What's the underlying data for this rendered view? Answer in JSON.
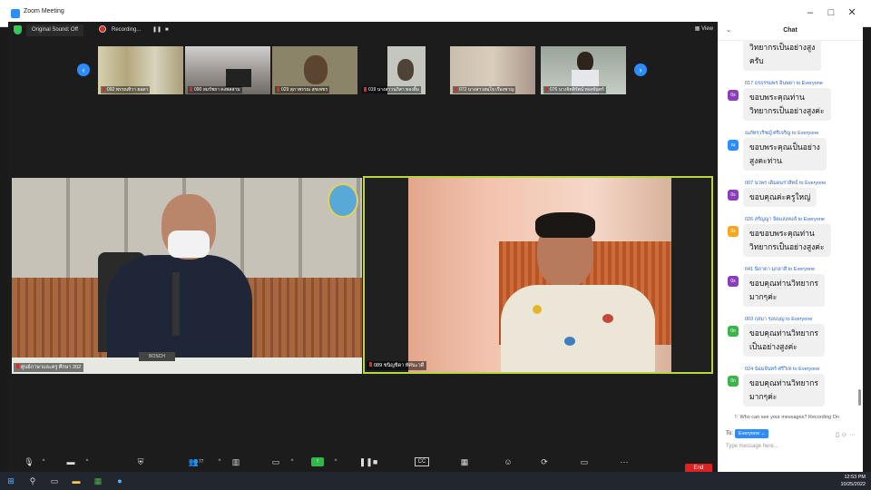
{
  "window": {
    "title": "Zoom Meeting"
  },
  "topbar": {
    "original_sound": "Original Sound: Off",
    "recording": "Recording...",
    "view": "View"
  },
  "thumbnails": [
    {
      "label": "092 พรรณทิวา ยอดา",
      "bg": "#c9c4a8"
    },
    {
      "label": "090 สมรัชยา คงพลสาม",
      "bg": "#8f8b88"
    },
    {
      "label": "029 สุภาพรรณ สุขเพชร",
      "bg": "#9c8f73"
    },
    {
      "label": "019 นางสาวนภิสา ทองยิ้ม",
      "bg": "#c8c8c4"
    },
    {
      "label": "072 นางสาวสมใจ เรืองชาญ",
      "bg": "#c2b6a4"
    },
    {
      "label": "076 นางจิตติรัตน์ ทองจันทร์",
      "bg": "#a6b0a8"
    }
  ],
  "main_videos": [
    {
      "label": "ศูนย์ภาษาและครู ศึกษา 202"
    },
    {
      "label": "089 ชนิญชิดา ทัศนะวดี"
    }
  ],
  "toolbar": {
    "participants_count": "77",
    "end": "End"
  },
  "chat": {
    "title": "Chat",
    "messages": [
      {
        "sender": "",
        "avatar": "",
        "color": "",
        "text": "วิทยากรเป็นอย่างสูง\nครับ"
      },
      {
        "sender": "017 ธรธรรมพร อินพยา to Everyone",
        "avatar": "0s",
        "color": "#8a3fb8",
        "text": "ขอบพระคุณท่าน\nวิทยากรเป็นอย่างสูงค่ะ"
      },
      {
        "sender": "ณภัทรวรีชญ์ ศรีเจริญ to Everyone",
        "avatar": "ณ",
        "color": "#2d8cff",
        "text": "ขอบพระคุณเป็นอย่าง\nสูงคะท่าน"
      },
      {
        "sender": "007 นวพร เดิมดนราสิทธ์ to Everyone",
        "avatar": "0s",
        "color": "#8a3fb8",
        "text": "ขอบคุณค่ะครูใหญ่"
      },
      {
        "sender": "026 สรัญญา จิตแสงหงส์ to Everyone",
        "avatar": "0s",
        "color": "#f5a623",
        "text": "ขอขอบพระคุณท่าน\nวิทยากรเป็นอย่างสูงค่ะ"
      },
      {
        "sender": "041 นิภาดา มุกลาสี to Everyone",
        "avatar": "0s",
        "color": "#8a3fb8",
        "text": "ขอบคุณท่านวิทยากร\nมากๆค่ะ"
      },
      {
        "sender": "003 กุสมา รอบบุญ to Everyone",
        "avatar": "0n",
        "color": "#3bb54a",
        "text": "ขอบคุณท่านวิทยากร\nเป็นอย่างสูงค่ะ"
      },
      {
        "sender": "024 น้อมจันทร์ ศรีวิเท to Everyone",
        "avatar": "0n",
        "color": "#3bb54a",
        "text": "ขอบคุณท่านวิทยากร\nมากๆค่ะ"
      }
    ],
    "who_can_see": "Who can see your messages? Recording On",
    "to_label": "To:",
    "recipient": "Everyone",
    "placeholder": "Type message here..."
  },
  "taskbar": {
    "time": "12:53 PM",
    "date": "10/25/2022"
  }
}
